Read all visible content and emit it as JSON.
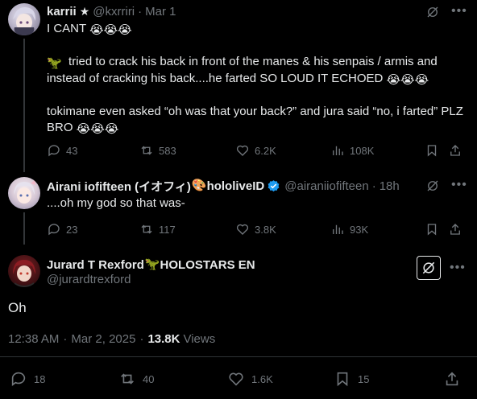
{
  "tweet1": {
    "name": "karrii",
    "star": "★",
    "handle": "@kxrriri",
    "sep": "·",
    "date": "Mar 1",
    "line1": "I CANT",
    "line1_emoji": "😭😭😭",
    "line2_emoji": "🦖",
    "line2": "tried to crack his back in front of the manes & his senpais / armis and instead of cracking his back....he farted SO LOUD IT ECHOED",
    "line2_end_emoji": "😭😭😭",
    "line3": "tokimane even asked “oh was that your back?” and jura said “no, i farted” PLZ BRO",
    "line3_emoji": "😭😭😭",
    "stats": {
      "replies": "43",
      "reposts": "583",
      "likes": "6.2K",
      "views": "108K"
    }
  },
  "tweet2": {
    "name": "Airani iofifteen (イオフィ)",
    "name_emoji": "🎨",
    "name_suffix": "hololiveID",
    "handle": "@airaniiofifteen",
    "sep": "·",
    "date": "18h",
    "text": "....oh my god so that was-",
    "stats": {
      "replies": "23",
      "reposts": "117",
      "likes": "3.8K",
      "views": "93K"
    }
  },
  "tweet3": {
    "name": "Jurard T Rexford",
    "name_emoji": "🦖",
    "name_suffix": "HOLOSTARS EN",
    "handle": "@jurardtrexford",
    "text": "Oh",
    "time": "12:38 AM",
    "sep": "·",
    "date": "Mar 2, 2025",
    "sep2": "·",
    "views_count": "13.8K",
    "views_label": "Views",
    "stats": {
      "replies": "18",
      "reposts": "40",
      "likes": "1.6K",
      "bookmarks": "15"
    }
  },
  "colors": {
    "background": "#000000",
    "text": "#e7e9ea",
    "muted": "#71767b",
    "divider": "#2f3336",
    "verified": "#1d9bf0"
  }
}
